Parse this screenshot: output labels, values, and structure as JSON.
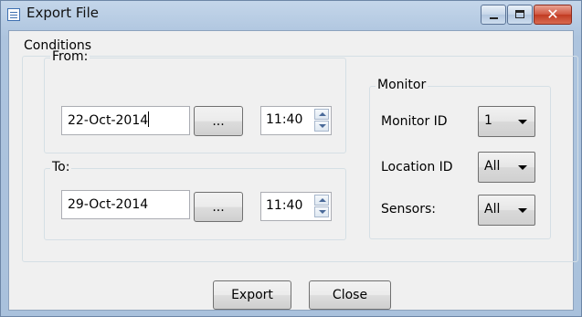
{
  "window": {
    "title": "Export File"
  },
  "conditions": {
    "label": "Conditions",
    "from": {
      "label": "From:",
      "date": "22-Oct-2014",
      "browse_label": "...",
      "time": "11:40"
    },
    "to": {
      "label": "To:",
      "date": "29-Oct-2014",
      "browse_label": "...",
      "time": "11:40"
    }
  },
  "monitor": {
    "label": "Monitor",
    "monitor_id": {
      "label": "Monitor ID",
      "value": "1"
    },
    "location_id": {
      "label": "Location ID",
      "value": "All"
    },
    "sensors": {
      "label": "Sensors:",
      "value": "All"
    }
  },
  "actions": {
    "export_label": "Export",
    "close_label": "Close"
  },
  "icons": {
    "app": "document-icon",
    "minimize": "minimize-icon",
    "maximize": "maximize-icon",
    "close": "close-icon"
  },
  "colors": {
    "titlebar": "#adc4de",
    "client": "#f0f0f0",
    "close_button": "#c13b22"
  }
}
